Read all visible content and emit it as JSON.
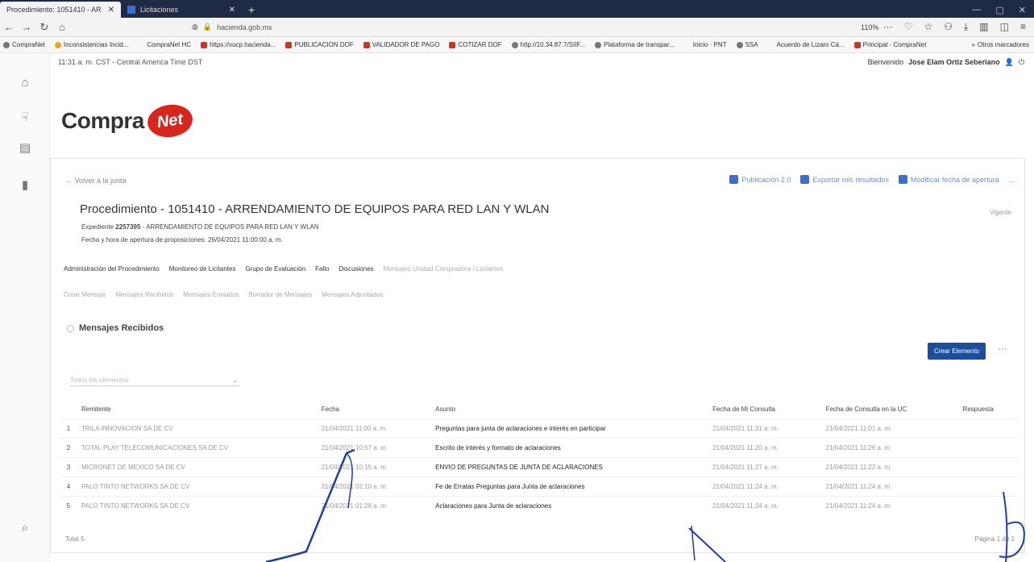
{
  "browser": {
    "tabs": [
      {
        "title": "Procedimiento: 1051410 - AR",
        "active": true
      },
      {
        "title": "Licitaciones",
        "active": false
      }
    ],
    "url": "hacienda.gob.mx",
    "zoom": "110%"
  },
  "bookmarks": [
    {
      "label": "CompraNet",
      "icon": "globe"
    },
    {
      "label": "Inconsistencias Incid...",
      "icon": "dot"
    },
    {
      "label": "CompraNet HC",
      "icon": "none"
    },
    {
      "label": "https://vucp.hacienda...",
      "icon": "red"
    },
    {
      "label": "PUBLICACION DOF",
      "icon": "red"
    },
    {
      "label": "VALIDADOR DE PAGO",
      "icon": "red"
    },
    {
      "label": "COTIZAR DOF",
      "icon": "red"
    },
    {
      "label": "http://10.34.87.7/SIIF...",
      "icon": "globe"
    },
    {
      "label": "Plataforma de transpar...",
      "icon": "globe"
    },
    {
      "label": "Inicio · PNT",
      "icon": "none"
    },
    {
      "label": "SSA",
      "icon": "globe"
    },
    {
      "label": "Acuerdo de Lizaro Cá...",
      "icon": "none"
    },
    {
      "label": "Principal - CompraNet",
      "icon": "red"
    }
  ],
  "bookmarks_more": "Otros marcadores",
  "info": {
    "time": "11:31 a. m. CST - Central America Time DST",
    "welcome_prefix": "Bienvenido",
    "user": "Jose Elam Ortiz Seberiano"
  },
  "logo": {
    "word": "Compra",
    "badge": "Net"
  },
  "panel": {
    "back": "Volver a la junta",
    "actions": [
      "Publicación 2.0",
      "Exportar mis resultados",
      "Modificar fecha de apertura",
      "..."
    ],
    "title": "Procedimiento - 1051410 - ARRENDAMIENTO DE EQUIPOS PARA RED LAN Y WLAN",
    "status": "Vigente",
    "expediente_label": "Expediente",
    "expediente_num": "2257395",
    "expediente_text": "- ARRENDAMIENTO DE EQUIPOS PARA RED LAN Y WLAN",
    "fecha_apertura": "Fecha y hora de apertura de proposiciones: 26/04/2021 11:00:00 a. m.",
    "tabs1": [
      {
        "label": "Administración del Procedimiento",
        "muted": false
      },
      {
        "label": "Monitoreo de Licitantes",
        "muted": false
      },
      {
        "label": "Grupo de Evaluación",
        "muted": false
      },
      {
        "label": "Fallo",
        "muted": false
      },
      {
        "label": "Discusiones",
        "muted": false
      },
      {
        "label": "Mensajes Unidad Compradora / Licitantes",
        "muted": true
      }
    ],
    "tabs2": [
      "Crear Mensaje",
      "Mensajes Recibidos",
      "Mensajes Enviados",
      "Borrador de Mensajes",
      "Mensajes Adjuntados"
    ],
    "section_title": "Mensajes Recibidos",
    "create_button": "Crear Elemento",
    "filter_placeholder": "Todos los elementos",
    "columns": [
      "",
      "Remitente",
      "Fecha",
      "Asunto",
      "Fecha de Mi Consulta",
      "Fecha de Consulta en la UC",
      "Respuesta"
    ],
    "rows": [
      [
        "1",
        "TRILA INNOVACION SA DE CV",
        "21/04/2021 11:00 a. m.",
        "Preguntas para junta de aclaraciones e interés en participar",
        "21/04/2021 11:31 a. m.",
        "21/04/2021 11:01 a. m.",
        ""
      ],
      [
        "2",
        "TOTAL PLAY TELECOMUNICACIONES SA DE CV",
        "21/04/2021 10:57 a. m.",
        "Escrito de interés y formato de aclaraciones",
        "21/04/2021 11:20 a. m.",
        "21/04/2021 11:26 a. m.",
        ""
      ],
      [
        "3",
        "MICRONET DE MEXICO SA DE CV",
        "21/04/2021 10:15 a. m.",
        "ENVIO DE PREGUNTAS DE JUNTA DE ACLARACIONES",
        "21/04/2021 11:27 a. m.",
        "21/04/2021 11:22 a. m.",
        ""
      ],
      [
        "4",
        "PALO TINTO NETWORKS SA DE CV",
        "21/04/2021 02:10 a. m.",
        "Fe de Erratas Preguntas para Junta de aclaraciones",
        "21/04/2021 11:24 a. m.",
        "21/04/2021 11:24 a. m.",
        ""
      ],
      [
        "5",
        "PALO TINTO NETWORKS SA DE CV",
        "21/04/2021 01:28 a. m.",
        "Aclaraciones para Junta de aclaraciones",
        "21/04/2021 11:24 a. m.",
        "21/04/2021 11:24 a. m.",
        ""
      ]
    ],
    "total": "Total 5",
    "page": "Página 1 de 1"
  }
}
